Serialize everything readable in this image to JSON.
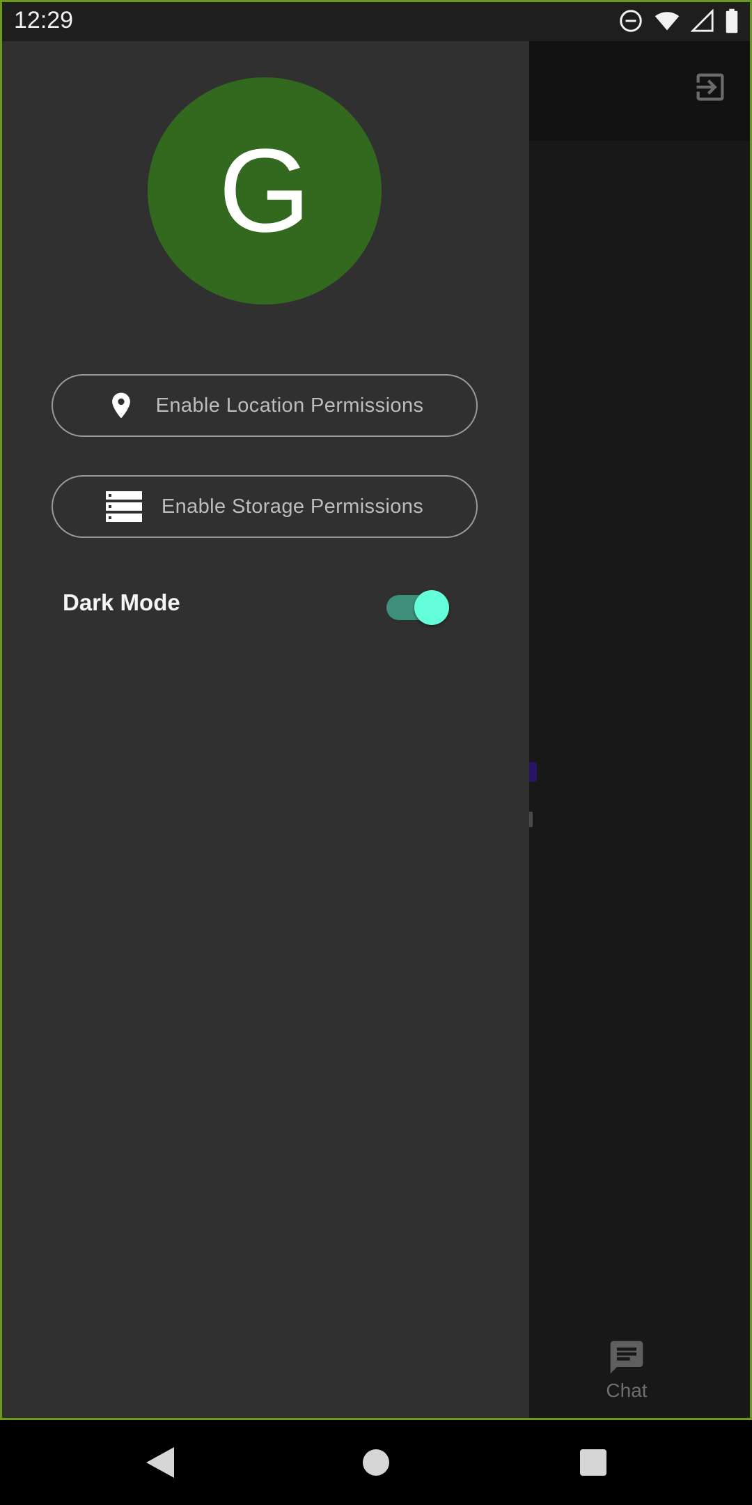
{
  "status_bar": {
    "time": "12:29",
    "icons": [
      "do-not-disturb-icon",
      "wifi-icon",
      "signal-icon",
      "battery-icon"
    ]
  },
  "app_bar": {
    "action_icon": "exit-to-app-icon"
  },
  "drawer": {
    "avatar_letter": "G",
    "avatar_color": "#33691e",
    "buttons": [
      {
        "label": "Enable Location Permissions",
        "icon": "location-pin-icon"
      },
      {
        "label": "Enable Storage Permissions",
        "icon": "storage-icon"
      }
    ],
    "dark_mode": {
      "label": "Dark Mode",
      "enabled": true,
      "accent": "#64ffda"
    }
  },
  "bottom_nav": {
    "items": [
      {
        "label": "Chat",
        "icon": "chat-icon"
      }
    ]
  },
  "nav_bar": {
    "buttons": [
      "back-icon",
      "home-icon",
      "recents-icon"
    ]
  }
}
